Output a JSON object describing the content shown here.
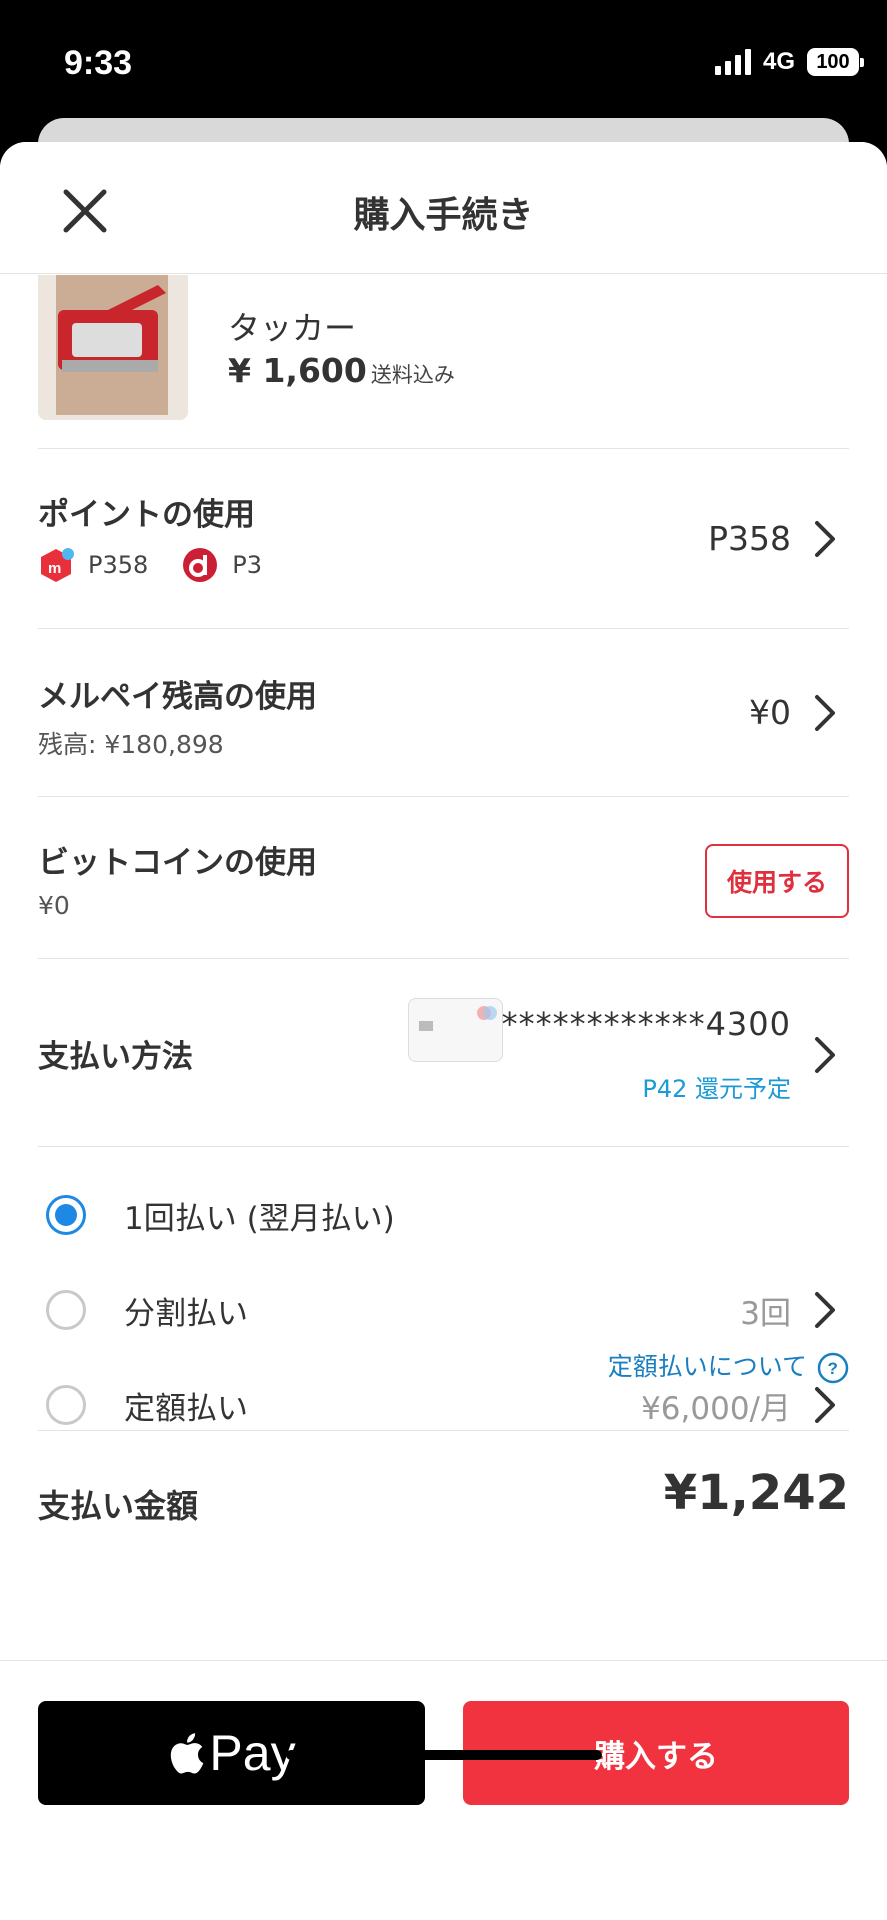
{
  "status": {
    "time": "9:33",
    "network": "4G",
    "battery": "100"
  },
  "header": {
    "title": "購入手続き"
  },
  "product": {
    "name": "タッカー",
    "price": "¥ 1,600",
    "shipping": "送料込み"
  },
  "points": {
    "title": "ポイントの使用",
    "mercari_points": "P358",
    "d_points": "P3",
    "value": "P358"
  },
  "merpay": {
    "title": "メルペイ残高の使用",
    "balance": "残高: ¥180,898",
    "value": "¥0"
  },
  "bitcoin": {
    "title": "ビットコインの使用",
    "value": "¥0",
    "button": "使用する"
  },
  "payment": {
    "title": "支払い方法",
    "card_number": "************4300",
    "reward": "P42 還元予定"
  },
  "options": [
    {
      "label": "1回払い (翌月払い)",
      "value": "",
      "selected": true
    },
    {
      "label": "分割払い",
      "value": "3回",
      "selected": false
    },
    {
      "label": "定額払い",
      "value": "¥6,000/月",
      "selected": false
    }
  ],
  "about_link": "定額払いについて",
  "total": {
    "label": "支払い金額",
    "value": "¥1,242"
  },
  "footer": {
    "apple_pay": "Pay",
    "buy": "購入する"
  },
  "colors": {
    "accent": "#f1323f",
    "link": "#1a7fc0",
    "radio": "#1e88e5"
  }
}
